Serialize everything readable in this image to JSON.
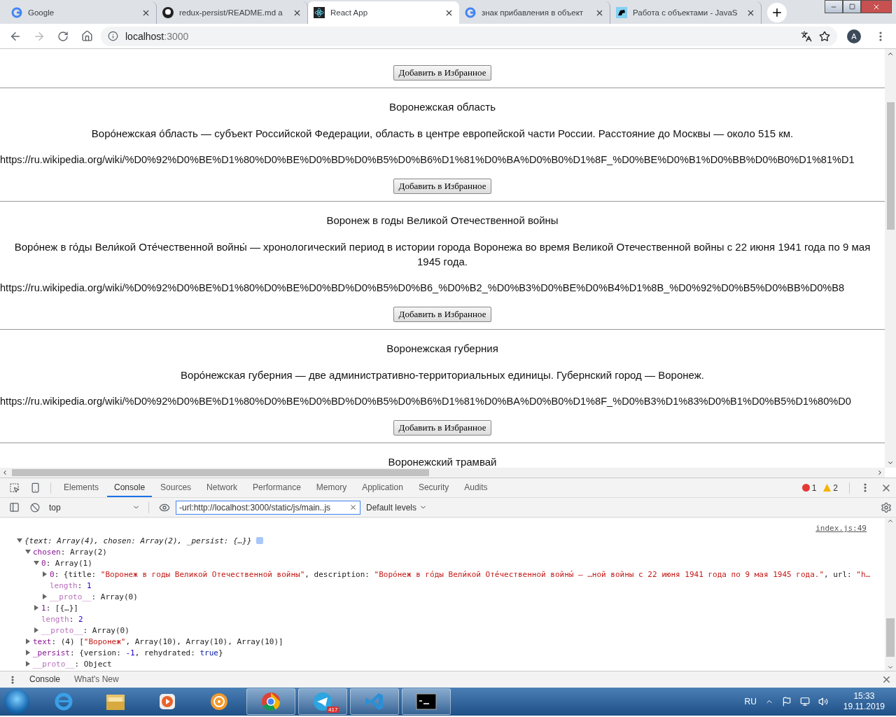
{
  "browser_tabs": [
    {
      "title": "Google",
      "selected": false
    },
    {
      "title": "redux-persist/README.md a",
      "selected": false
    },
    {
      "title": "React App",
      "selected": true
    },
    {
      "title": "знак прибавления в объект",
      "selected": false
    },
    {
      "title": "Работа с объектами - JavaS",
      "selected": false
    }
  ],
  "address_bar": {
    "host": "localhost",
    "port": ":3000",
    "avatar": "A"
  },
  "articles": [
    {
      "button": "Добавить в Избранное"
    },
    {
      "title": "Воронежская область",
      "description": "Воро́нежская о́бласть — субъект Российской Федерации, область в центре европейской части России. Расстояние до Москвы — около 515 км.",
      "url": "https://ru.wikipedia.org/wiki/%D0%92%D0%BE%D1%80%D0%BE%D0%BD%D0%B5%D0%B6%D1%81%D0%BA%D0%B0%D1%8F_%D0%BE%D0%B1%D0%BB%D0%B0%D1%81%D1",
      "button": "Добавить в Избранное"
    },
    {
      "title": "Воронеж в годы Великой Отечественной войны",
      "description": "Воро́неж в го́ды Вели́кой Оте́чественной войны́ — хронологический период в истории города Воронежа во время Великой Отечественной войны с 22 июня 1941 года по 9 мая 1945 года.",
      "url": "https://ru.wikipedia.org/wiki/%D0%92%D0%BE%D1%80%D0%BE%D0%BD%D0%B5%D0%B6_%D0%B2_%D0%B3%D0%BE%D0%B4%D1%8B_%D0%92%D0%B5%D0%BB%D0%B8",
      "button": "Добавить в Избранное"
    },
    {
      "title": "Воронежская губерния",
      "description": "Воро́нежская губерния — две административно-территориальных единицы. Губернский город — Воронеж.",
      "url": "https://ru.wikipedia.org/wiki/%D0%92%D0%BE%D1%80%D0%BE%D0%BD%D0%B5%D0%B6%D1%81%D0%BA%D0%B0%D1%8F_%D0%B3%D1%83%D0%B1%D0%B5%D1%80%D0",
      "button": "Добавить в Избранное"
    },
    {
      "title": "Воронежский трамвай"
    }
  ],
  "devtools": {
    "tabs": [
      {
        "label": "Elements",
        "selected": false
      },
      {
        "label": "Console",
        "selected": true
      },
      {
        "label": "Sources",
        "selected": false
      },
      {
        "label": "Network",
        "selected": false
      },
      {
        "label": "Performance",
        "selected": false
      },
      {
        "label": "Memory",
        "selected": false
      },
      {
        "label": "Application",
        "selected": false
      },
      {
        "label": "Security",
        "selected": false
      },
      {
        "label": "Audits",
        "selected": false
      }
    ],
    "errors": "1",
    "warnings": "2",
    "context": "top",
    "filter": "-url:http://localhost:3000/static/js/main..js",
    "levels": "Default levels",
    "console": [
      {
        "kind": "object",
        "expanded": true,
        "italic": true,
        "source": "index.js:49",
        "parts": [
          {
            "kind": "plain",
            "text": "{text: Array(4), chosen: Array(2), _persist: {…}}"
          }
        ],
        "children": [
          {
            "kind": "object",
            "expanded": true,
            "parts": [
              {
                "kind": "key",
                "text": "chosen"
              },
              {
                "kind": "plain",
                "text": ": Array(2)"
              }
            ],
            "children": [
              {
                "kind": "object",
                "expanded": true,
                "parts": [
                  {
                    "kind": "key",
                    "text": "0"
                  },
                  {
                    "kind": "plain",
                    "text": ": Array(1)"
                  }
                ],
                "children": [
                  {
                    "kind": "object",
                    "expanded": false,
                    "parts": [
                      {
                        "kind": "key",
                        "text": "0"
                      },
                      {
                        "kind": "plain",
                        "text": ": {title: "
                      },
                      {
                        "kind": "string",
                        "text": "\"Воронеж в годы Великой Отечественной войны\""
                      },
                      {
                        "kind": "plain",
                        "text": ", description: "
                      },
                      {
                        "kind": "string",
                        "text": "\"Воро́неж в го́ды Вели́кой Оте́чественной войны́ — …ной войны с 22 июня 1941 года по 9 мая 1945 года.\""
                      },
                      {
                        "kind": "plain",
                        "text": ", url: "
                      },
                      {
                        "kind": "string",
                        "text": "\"h…"
                      }
                    ]
                  },
                  {
                    "kind": "property",
                    "parts": [
                      {
                        "kind": "dimkey",
                        "text": "length"
                      },
                      {
                        "kind": "plain",
                        "text": ": "
                      },
                      {
                        "kind": "number",
                        "text": "1"
                      }
                    ]
                  },
                  {
                    "kind": "object",
                    "expanded": false,
                    "parts": [
                      {
                        "kind": "dimkey",
                        "text": "__proto__"
                      },
                      {
                        "kind": "plain",
                        "text": ": Array(0)"
                      }
                    ]
                  }
                ]
              },
              {
                "kind": "object",
                "expanded": false,
                "parts": [
                  {
                    "kind": "key",
                    "text": "1"
                  },
                  {
                    "kind": "plain",
                    "text": ": [{…}]"
                  }
                ]
              },
              {
                "kind": "property",
                "parts": [
                  {
                    "kind": "dimkey",
                    "text": "length"
                  },
                  {
                    "kind": "plain",
                    "text": ": "
                  },
                  {
                    "kind": "number",
                    "text": "2"
                  }
                ]
              },
              {
                "kind": "object",
                "expanded": false,
                "parts": [
                  {
                    "kind": "dimkey",
                    "text": "__proto__"
                  },
                  {
                    "kind": "plain",
                    "text": ": Array(0)"
                  }
                ]
              }
            ]
          },
          {
            "kind": "object",
            "expanded": false,
            "parts": [
              {
                "kind": "key",
                "text": "text"
              },
              {
                "kind": "plain",
                "text": ": (4) ["
              },
              {
                "kind": "string",
                "text": "\"Воронеж\""
              },
              {
                "kind": "plain",
                "text": ", Array(10), Array(10), Array(10)]"
              }
            ]
          },
          {
            "kind": "object",
            "expanded": false,
            "parts": [
              {
                "kind": "key",
                "text": "_persist"
              },
              {
                "kind": "plain",
                "text": ": {version: "
              },
              {
                "kind": "number",
                "text": "-1"
              },
              {
                "kind": "plain",
                "text": ", rehydrated: "
              },
              {
                "kind": "keyword",
                "text": "true"
              },
              {
                "kind": "plain",
                "text": "}"
              }
            ]
          },
          {
            "kind": "object",
            "expanded": false,
            "parts": [
              {
                "kind": "dimkey",
                "text": "__proto__"
              },
              {
                "kind": "plain",
                "text": ": Object"
              }
            ]
          }
        ]
      }
    ],
    "drawer_tabs": [
      {
        "label": "Console",
        "selected": true
      },
      {
        "label": "What's New",
        "selected": false
      }
    ]
  },
  "taskbar": {
    "items": [
      {
        "kind": "ie",
        "running": false
      },
      {
        "kind": "explorer",
        "running": false
      },
      {
        "kind": "media",
        "running": false
      },
      {
        "kind": "gear",
        "running": false
      },
      {
        "kind": "chrome",
        "running": true
      },
      {
        "kind": "telegram",
        "running": true,
        "badge": "417"
      },
      {
        "kind": "vscode",
        "running": true
      },
      {
        "kind": "cmd",
        "running": true
      }
    ],
    "language": "RU",
    "time": "15:33",
    "date": "19.11.2019"
  }
}
